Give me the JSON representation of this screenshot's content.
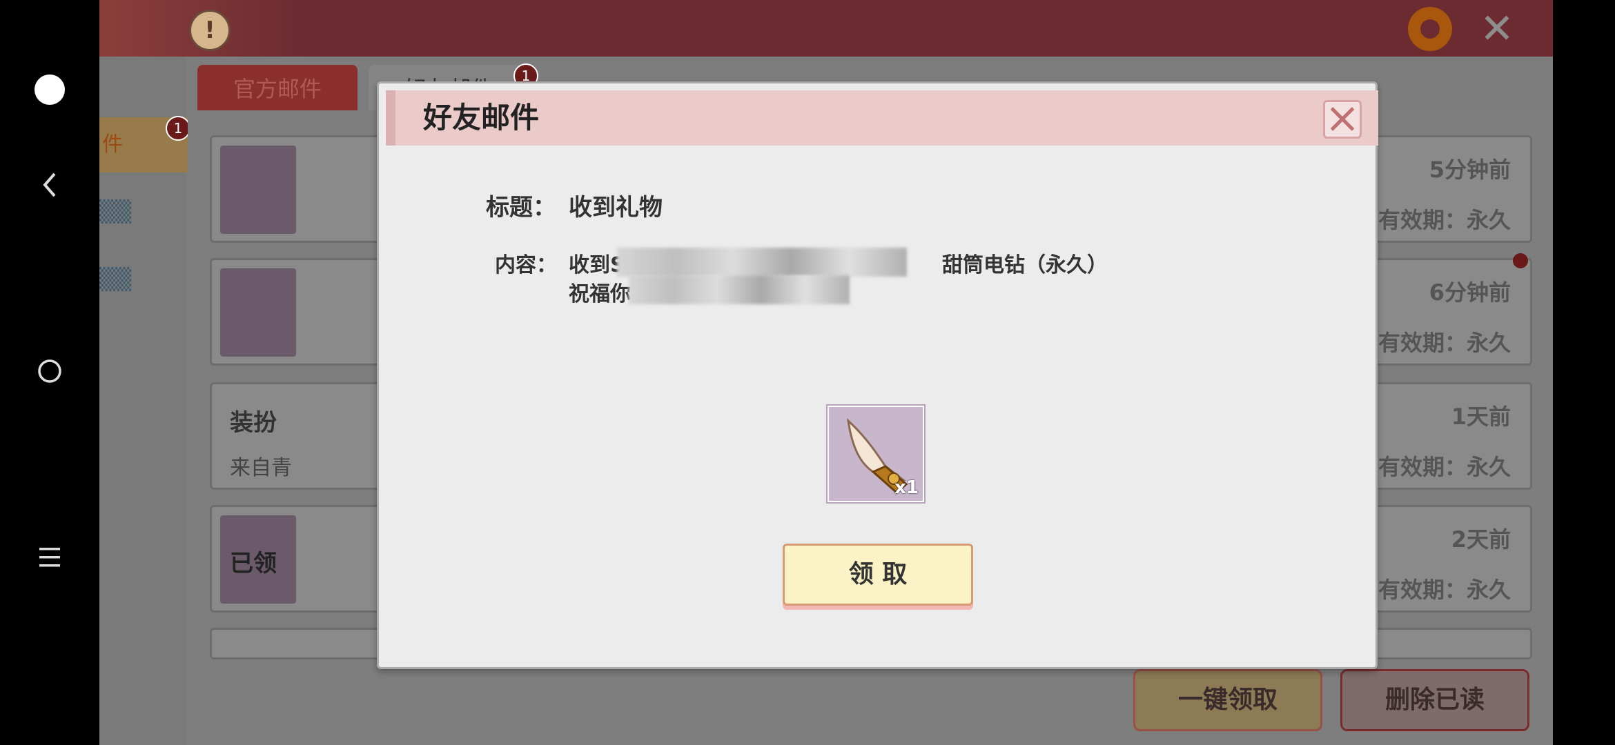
{
  "android_nav": {
    "dot_icon": "record-circle-icon",
    "back_icon": "back-icon",
    "home_icon": "home-icon",
    "menu_icon": "menu-icon"
  },
  "top": {
    "warning_icon": "info-icon",
    "warning_glyph": "!",
    "settings_icon": "gear-icon",
    "close_icon": "close-icon"
  },
  "sidebar": {
    "tab_label": "件",
    "badge": "1"
  },
  "tabs": [
    {
      "label": "官方邮件"
    },
    {
      "label": "好友邮件",
      "badge": "1"
    }
  ],
  "mail_list": [
    {
      "time": "5分钟前",
      "validity": "有效期：永久"
    },
    {
      "time": "6分钟前",
      "validity": "有效期：永久"
    },
    {
      "title": "装扮",
      "from": "来自青",
      "time": "1天前",
      "validity": "有效期：永久"
    },
    {
      "thumb_label": "已领",
      "time": "2天前",
      "validity": "有效期：永久"
    }
  ],
  "bottom_buttons": {
    "claim_all": "一键领取",
    "delete_read": "删除已读"
  },
  "modal": {
    "header_title": "好友邮件",
    "title_label": "标题：",
    "title_value": "收到礼物",
    "content_label": "内容：",
    "content_line1_prefix": "收到S",
    "content_line1_suffix": "甜筒电钻（永久）",
    "content_line2_prefix": "祝福你",
    "item_name": "ice-cream-cone-icon",
    "item_qty": "x1",
    "claim_button": "领 取"
  },
  "colors": {
    "overlay": "#7d7d7d",
    "modal_bg": "#ececec",
    "header_bg": "#ebcaca",
    "claim_bg": "#fbf2c6",
    "next_arrow": "#a35412"
  }
}
